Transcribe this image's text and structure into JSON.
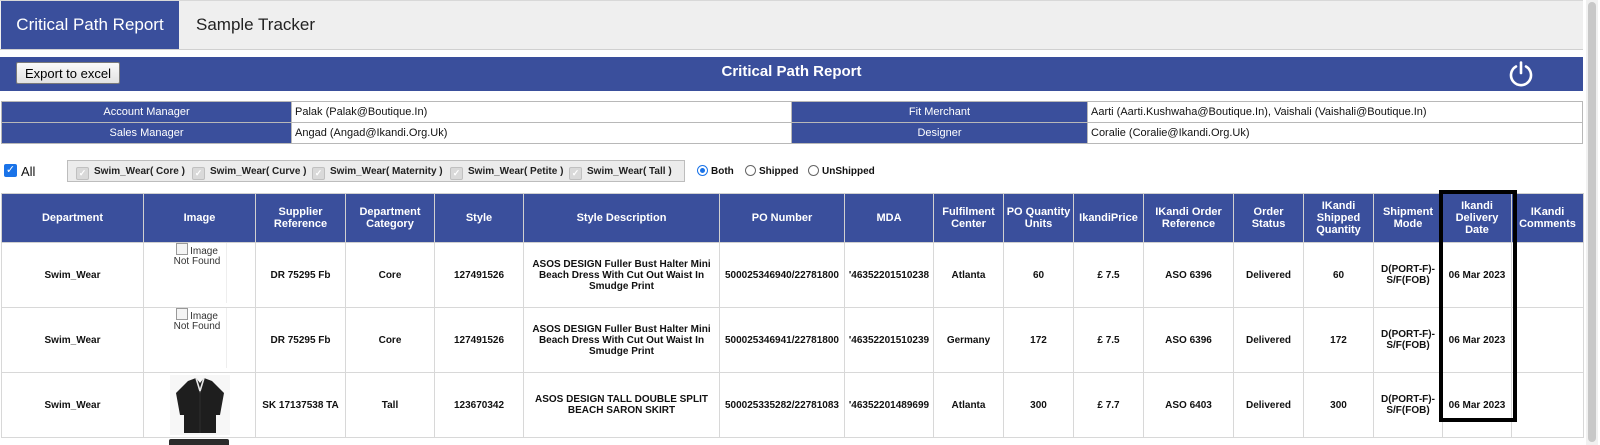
{
  "tabs": [
    {
      "label": "Critical Path Report",
      "active": true
    },
    {
      "label": "Sample Tracker",
      "active": false
    }
  ],
  "toolbar": {
    "export_label": "Export to excel",
    "title": "Critical Path Report",
    "power_icon": "power-icon"
  },
  "info": {
    "account_manager_label": "Account Manager",
    "account_manager_value": "Palak (Palak@Boutique.In)",
    "fit_merchant_label": "Fit Merchant",
    "fit_merchant_value": "Aarti (Aarti.Kushwaha@Boutique.In), Vaishali (Vaishali@Boutique.In)",
    "sales_manager_label": "Sales Manager",
    "sales_manager_value": "Angad (Angad@Ikandi.Org.Uk)",
    "designer_label": "Designer",
    "designer_value": "Coralie (Coralie@Ikandi.Org.Uk)"
  },
  "filters": {
    "all_label": "All",
    "all_checked": true,
    "categories": [
      "Swim_Wear( Core )",
      "Swim_Wear( Curve )",
      "Swim_Wear( Maternity )",
      "Swim_Wear( Petite )",
      "Swim_Wear( Tall )"
    ],
    "ship_options": [
      "Both",
      "Shipped",
      "UnShipped"
    ],
    "ship_selected": "Both"
  },
  "table": {
    "headers": [
      "Department",
      "Image",
      "Supplier Reference",
      "Department Category",
      "Style",
      "Style Description",
      "PO Number",
      "MDA",
      "Fulfilment Center",
      "PO Quantity Units",
      "IkandiPrice",
      "IKandi Order Reference",
      "Order Status",
      "IKandi Shipped Quantity",
      "Shipment Mode",
      "Ikandi Delivery Date",
      "IKandi Comments"
    ],
    "image_alt": "Image Not Found",
    "rows": [
      {
        "department": "Swim_Wear",
        "image": "broken",
        "supplier_ref": "DR 75295 Fb",
        "dept_category": "Core",
        "style": "127491526",
        "style_desc": "ASOS DESIGN Fuller Bust Halter Mini Beach Dress With Cut Out Waist In Smudge Print",
        "po_number": "500025346940/22781800",
        "mda": "'46352201510238",
        "fulfilment": "Atlanta",
        "po_qty": "60",
        "price": "£ 7.5",
        "order_ref": "ASO 6396",
        "status": "Delivered",
        "shipped_qty": "60",
        "ship_mode": "D(PORT-F)-S/F(FOB)",
        "delivery_date": "06 Mar 2023",
        "comments": ""
      },
      {
        "department": "Swim_Wear",
        "image": "broken",
        "supplier_ref": "DR 75295 Fb",
        "dept_category": "Core",
        "style": "127491526",
        "style_desc": "ASOS DESIGN Fuller Bust Halter Mini Beach Dress With Cut Out Waist In Smudge Print",
        "po_number": "500025346941/22781800",
        "mda": "'46352201510239",
        "fulfilment": "Germany",
        "po_qty": "172",
        "price": "£ 7.5",
        "order_ref": "ASO 6396",
        "status": "Delivered",
        "shipped_qty": "172",
        "ship_mode": "D(PORT-F)-S/F(FOB)",
        "delivery_date": "06 Mar 2023",
        "comments": ""
      },
      {
        "department": "Swim_Wear",
        "image": "photo",
        "supplier_ref": "SK 17137538 TA",
        "dept_category": "Tall",
        "style": "123670342",
        "style_desc": "ASOS DESIGN TALL DOUBLE SPLIT BEACH SARON SKIRT",
        "po_number": "500025335282/22781083",
        "mda": "'46352201489699",
        "fulfilment": "Atlanta",
        "po_qty": "300",
        "price": "£ 7.7",
        "order_ref": "ASO 6403",
        "status": "Delivered",
        "shipped_qty": "300",
        "ship_mode": "D(PORT-F)-S/F(FOB)",
        "delivery_date": "06 Mar 2023",
        "comments": ""
      }
    ]
  },
  "colors": {
    "header_blue": "#3a4f9c",
    "checkbox_blue": "#1a73e8",
    "highlight_border": "#000000"
  }
}
